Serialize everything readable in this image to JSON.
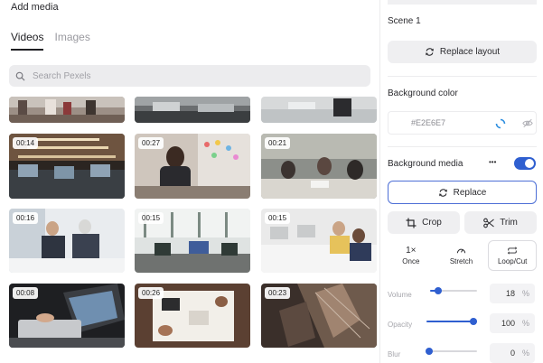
{
  "media_panel": {
    "title": "Add media",
    "tabs": [
      {
        "label": "Videos",
        "active": true
      },
      {
        "label": "Images",
        "active": false
      }
    ],
    "search_placeholder": "Search Pexels",
    "tiles": [
      {
        "duration": "",
        "theme": "office-meeting"
      },
      {
        "duration": "",
        "theme": "office-desks"
      },
      {
        "duration": "",
        "theme": "office-wall"
      },
      {
        "duration": "00:14",
        "theme": "open-office"
      },
      {
        "duration": "00:27",
        "theme": "woman-phone"
      },
      {
        "duration": "00:21",
        "theme": "team-meeting"
      },
      {
        "duration": "00:16",
        "theme": "business-men"
      },
      {
        "duration": "00:15",
        "theme": "lounge"
      },
      {
        "duration": "00:15",
        "theme": "coworking"
      },
      {
        "duration": "00:08",
        "theme": "laptop-hands"
      },
      {
        "duration": "00:26",
        "theme": "desk-top-view"
      },
      {
        "duration": "00:23",
        "theme": "aerial-city"
      }
    ]
  },
  "properties_panel": {
    "scene_label": "Scene 1",
    "replace_layout_label": "Replace layout",
    "background_color_label": "Background color",
    "background_color_hex": "#E2E6E7",
    "background_media_label": "Background media",
    "more_label": "•••",
    "background_media_enabled": true,
    "replace_label": "Replace",
    "crop_label": "Crop",
    "trim_label": "Trim",
    "modes": [
      {
        "icon_text": "1×",
        "label": "Once",
        "active": false
      },
      {
        "icon_text": "",
        "label": "Stretch",
        "active": false
      },
      {
        "icon_text": "",
        "label": "Loop/Cut",
        "active": true
      }
    ],
    "sliders": [
      {
        "label": "Volume",
        "value": 18,
        "max": 100,
        "unit": "%"
      },
      {
        "label": "Opacity",
        "value": 100,
        "max": 100,
        "unit": "%"
      },
      {
        "label": "Blur",
        "value": 0,
        "max": 100,
        "unit": "%"
      }
    ]
  },
  "colors": {
    "accent": "#2f5fd0",
    "outline_accent": "#4d6fd6",
    "swatch": "#E2E6E7"
  }
}
